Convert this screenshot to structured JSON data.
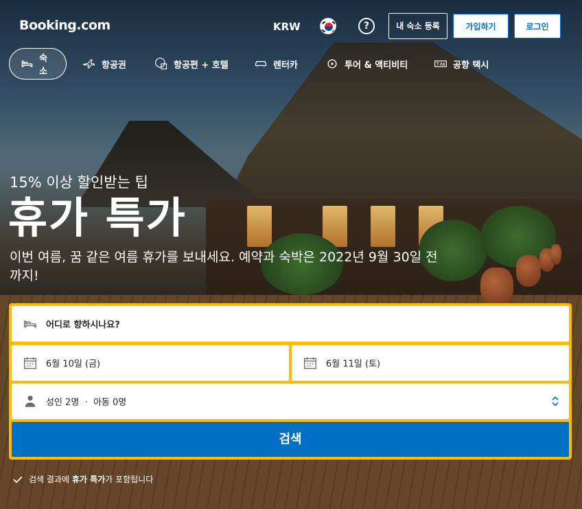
{
  "header": {
    "logo": "Booking.com",
    "currency": "KRW",
    "help_label": "?",
    "list_property": "내 숙소 등록",
    "signup": "가입하기",
    "login": "로그인"
  },
  "nav": {
    "tabs": [
      {
        "label": "숙소",
        "icon": "bed-icon",
        "active": true
      },
      {
        "label": "항공권",
        "icon": "plane-icon",
        "active": false
      },
      {
        "label": "항공편 + 호텔",
        "icon": "plane-hotel-icon",
        "active": false
      },
      {
        "label": "렌터카",
        "icon": "car-icon",
        "active": false
      },
      {
        "label": "투어 & 액티비티",
        "icon": "attractions-icon",
        "active": false
      },
      {
        "label": "공항 택시",
        "icon": "taxi-icon",
        "active": false
      }
    ]
  },
  "hero": {
    "kicker": "15% 이상 할인받는 팁",
    "headline": "휴가 특가",
    "subline": "이번 여름, 꿈 같은 여름 휴가를 보내세요. 예약과 숙박은 2022년 9월 30일 전까지!"
  },
  "search": {
    "destination_placeholder": "어디로 향하시나요?",
    "checkin": "6월 10일 (금)",
    "checkout": "6월 11일 (토)",
    "guests_adults": "성인 2명",
    "guests_sep": "·",
    "guests_children": "아동 0명",
    "button": "검색"
  },
  "note": {
    "pre": "검색 결과에",
    "bold": "휴가 특가",
    "post": "가 포함됩니다"
  },
  "colors": {
    "brand_blue": "#0071c2",
    "search_yellow": "#febb02"
  }
}
